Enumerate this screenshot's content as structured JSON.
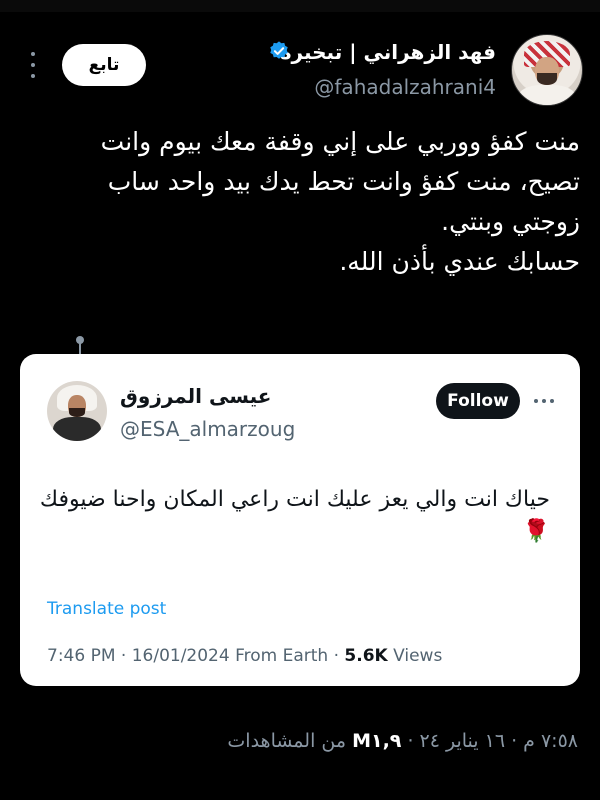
{
  "header": {
    "display_name": "فهد الزهراني | تبخيرة",
    "handle": "@fahadalzahrani4",
    "follow_label": "تابع"
  },
  "tweet": {
    "lines": [
      "منت كفؤ وو‏ربي على إني وقفة معك بيوم وانت",
      "تصيح، منت كفؤ وانت تحط يدك بيد واحد ساب",
      "زوجتي وبنتي.",
      "حسابك عندي بأذن الله."
    ]
  },
  "quoted": {
    "name": "عيسى المرزوق",
    "handle": "@ESA_almarzoug",
    "follow_label": "Follow",
    "text": "حياك انت والي يعز عليك انت راعي المكان واحنا ضيوفك",
    "emoji": "🌹",
    "translate_label": "Translate post",
    "time_date": "7:46 PM · 16/01/2024 From Earth · ",
    "views_count": "5.6K",
    "views_label": " Views"
  },
  "footer": {
    "timestamp": "٧:٥٨ م · ١٦ يناير ٢٤ · ",
    "views_count": "M١,٩",
    "views_label": " من المشاهدات"
  },
  "colors": {
    "background": "#000000",
    "verified": "#1d9bf0",
    "link": "#1d9bf0",
    "muted": "#8b98a5"
  },
  "icons": [
    "verified-badge-icon",
    "more-vertical-icon",
    "more-horizontal-icon"
  ]
}
